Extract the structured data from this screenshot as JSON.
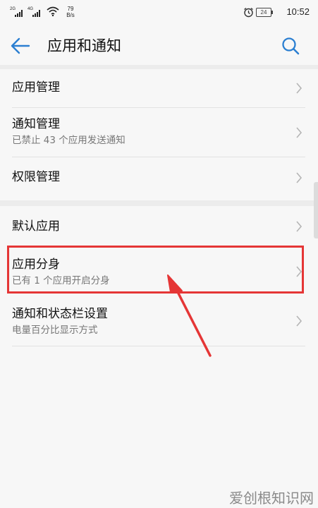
{
  "status_bar": {
    "sim1_tag": "2G",
    "sim2_tag": "4G",
    "net_speed_value": "79",
    "net_speed_unit": "B/s",
    "battery": "24",
    "time": "10:52"
  },
  "header": {
    "title": "应用和通知"
  },
  "list": {
    "items": [
      {
        "title": "应用管理",
        "subtitle": ""
      },
      {
        "title": "通知管理",
        "subtitle": "已禁止 43 个应用发送通知"
      },
      {
        "title": "权限管理",
        "subtitle": ""
      },
      {
        "title": "默认应用",
        "subtitle": ""
      },
      {
        "title": "应用分身",
        "subtitle": "已有 1 个应用开启分身"
      },
      {
        "title": "通知和状态栏设置",
        "subtitle": "电量百分比显示方式"
      }
    ]
  },
  "watermark": "爱创根知识网",
  "colors": {
    "accent": "#2b7fd1",
    "highlight": "#e53636"
  }
}
